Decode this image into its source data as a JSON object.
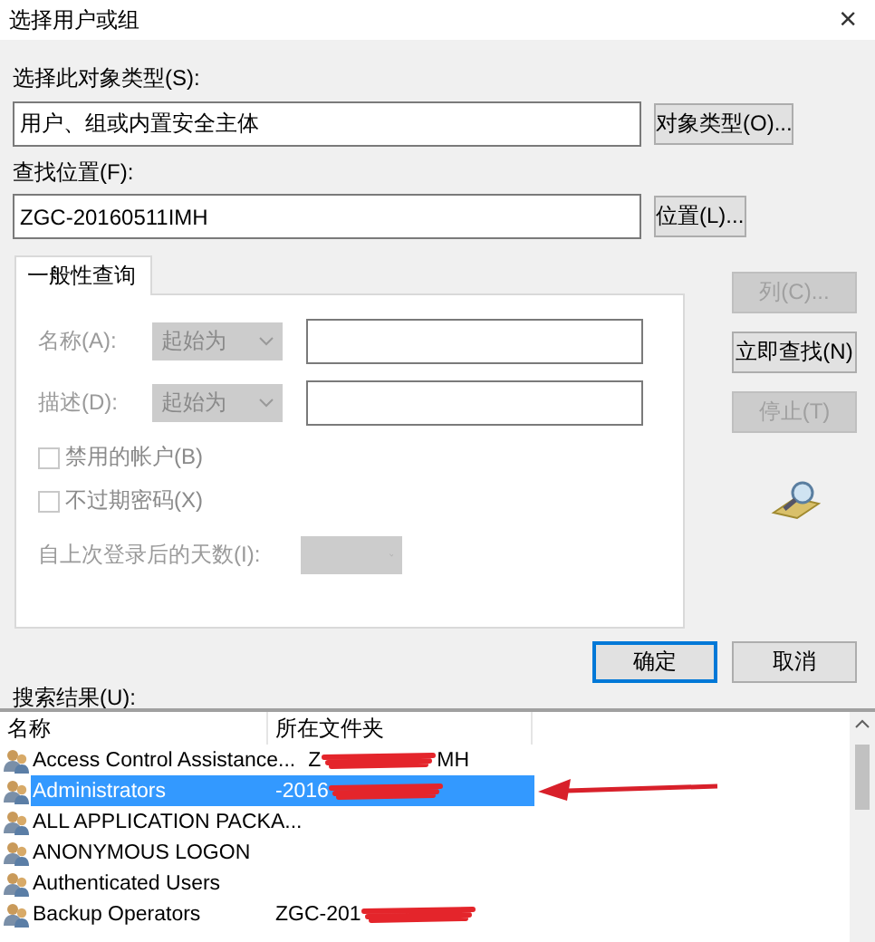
{
  "window": {
    "title": "选择用户或组",
    "close": "×"
  },
  "object_type": {
    "label": "选择此对象类型(S):",
    "value": "用户、组或内置安全主体",
    "button": "对象类型(O)..."
  },
  "location": {
    "label": "查找位置(F):",
    "value": "ZGC-20160511IMH",
    "button": "位置(L)..."
  },
  "tabs": [
    {
      "label": "一般性查询",
      "selected": true
    }
  ],
  "query": {
    "disabled": true,
    "fields": [
      {
        "label": "名称(A):",
        "mode": "起始为"
      },
      {
        "label": "描述(D):",
        "mode": "起始为"
      }
    ],
    "checkboxes": [
      {
        "label": "禁用的帐户(B)",
        "checked": false
      },
      {
        "label": "不过期密码(X)",
        "checked": false
      }
    ],
    "days_label": "自上次登录后的天数(I):"
  },
  "side_buttons": [
    {
      "label": "列(C)...",
      "disabled": true
    },
    {
      "label": "立即查找(N)",
      "disabled": false
    },
    {
      "label": "停止(T)",
      "disabled": true
    }
  ],
  "dialog_buttons": [
    {
      "label": "确定",
      "default": true
    },
    {
      "label": "取消",
      "default": false
    }
  ],
  "results": {
    "label": "搜索结果(U):",
    "columns": [
      "名称",
      "所在文件夹"
    ],
    "rows": [
      {
        "name": "Access Control Assistance...",
        "folder": "Z",
        "folder_end": "MH",
        "redacted": true,
        "selected": false
      },
      {
        "name": "Administrators",
        "folder": "-2016",
        "redacted": true,
        "selected": true
      },
      {
        "name": "ALL APPLICATION PACKA...",
        "redacted": false,
        "selected": false
      },
      {
        "name": "ANONYMOUS LOGON",
        "redacted": false,
        "selected": false
      },
      {
        "name": "Authenticated Users",
        "redacted": false,
        "selected": false
      },
      {
        "name": "Backup Operators",
        "folder": "ZGC-201",
        "redacted": true,
        "selected": false
      }
    ]
  },
  "annotations": [
    {
      "kind": "arrow"
    }
  ]
}
